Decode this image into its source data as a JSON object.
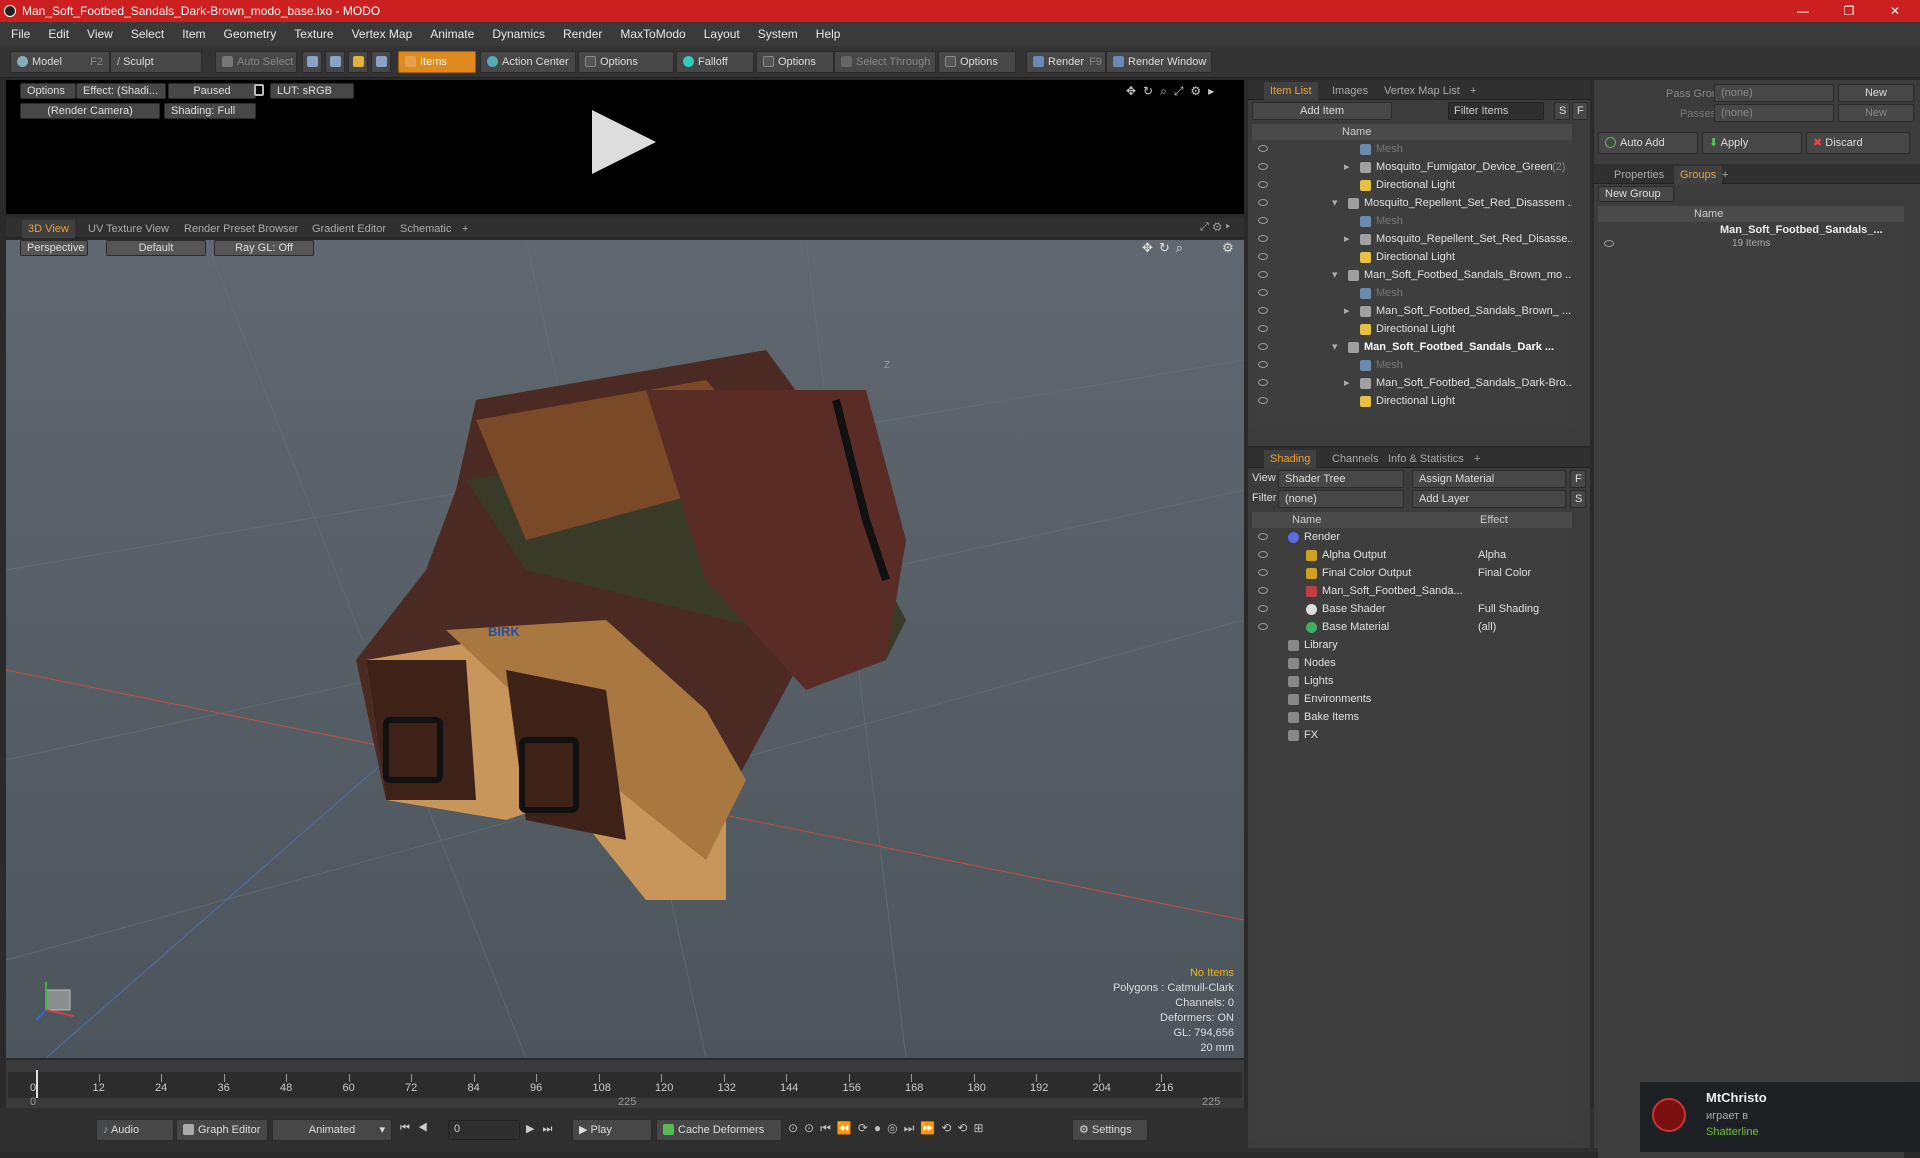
{
  "window": {
    "title": "Man_Soft_Footbed_Sandals_Dark-Brown_modo_base.lxo - MODO",
    "min": "—",
    "max": "❒",
    "close": "✕"
  },
  "menu": [
    "File",
    "Edit",
    "View",
    "Select",
    "Item",
    "Geometry",
    "Texture",
    "Vertex Map",
    "Animate",
    "Dynamics",
    "Render",
    "MaxToModo",
    "Layout",
    "System",
    "Help"
  ],
  "toolbar": {
    "model": "Model",
    "model_key": "F2",
    "sculpt": "Sculpt",
    "auto_select": "Auto Select",
    "items": "Items",
    "action_center": "Action Center",
    "options1": "Options",
    "falloff": "Falloff",
    "options2": "Options",
    "select_through": "Select Through",
    "options3": "Options",
    "render": "Render",
    "render_key": "F9",
    "render_window": "Render Window"
  },
  "preview": {
    "options": "Options",
    "effect": "Effect: (Shadi...",
    "paused": "Paused",
    "lut": "LUT: sRGB",
    "camera": "(Render Camera)",
    "shading": "Shading: Full"
  },
  "viewport_tabs": [
    "3D View",
    "UV Texture View",
    "Render Preset Browser",
    "Gradient Editor",
    "Schematic",
    "+"
  ],
  "viewport": {
    "perspective": "Perspective",
    "default": "Default",
    "raygl": "Ray GL: Off",
    "axis_label": "Z",
    "brand": "BIRK",
    "info": {
      "no_items": "No Items",
      "polygons": "Polygons : Catmull-Clark",
      "channels": "Channels: 0",
      "deformers": "Deformers: ON",
      "gl": "GL: 794,656",
      "size": "20 mm"
    }
  },
  "timeline": {
    "ticks": [
      "0",
      "12",
      "24",
      "36",
      "48",
      "60",
      "72",
      "84",
      "96",
      "108",
      "120",
      "132",
      "144",
      "156",
      "168",
      "180",
      "192",
      "204",
      "216"
    ],
    "start": "0",
    "mid": "225",
    "end": "225"
  },
  "bottom": {
    "audio": "Audio",
    "graph_editor": "Graph Editor",
    "animated": "Animated",
    "frame": "0",
    "play": "Play",
    "cache": "Cache Deformers",
    "settings": "Settings"
  },
  "item_list": {
    "tabs": [
      "Item List",
      "Images",
      "Vertex Map List",
      "+"
    ],
    "add_item": "Add Item",
    "filter": "Filter Items",
    "s": "S",
    "f": "F",
    "col_name": "Name",
    "rows": [
      {
        "label": "Mesh",
        "indent": 2,
        "dim": true
      },
      {
        "label": "Mosquito_Fumigator_Device_Green",
        "suffix": "(2)",
        "indent": 2,
        "dim": false
      },
      {
        "label": "Directional Light",
        "indent": 2,
        "dim": false
      },
      {
        "label": "Mosquito_Repellent_Set_Red_Disassem ...",
        "indent": 1,
        "dim": false
      },
      {
        "label": "Mesh",
        "indent": 2,
        "dim": true
      },
      {
        "label": "Mosquito_Repellent_Set_Red_Disasse...",
        "indent": 2,
        "dim": false
      },
      {
        "label": "Directional Light",
        "indent": 2,
        "dim": false
      },
      {
        "label": "Man_Soft_Footbed_Sandals_Brown_mo ...",
        "indent": 1,
        "dim": false
      },
      {
        "label": "Mesh",
        "indent": 2,
        "dim": true
      },
      {
        "label": "Man_Soft_Footbed_Sandals_Brown_ ...",
        "indent": 2,
        "dim": false
      },
      {
        "label": "Directional Light",
        "indent": 2,
        "dim": false
      },
      {
        "label": "Man_Soft_Footbed_Sandals_Dark ...",
        "indent": 1,
        "dim": false,
        "bold": true
      },
      {
        "label": "Mesh",
        "indent": 2,
        "dim": true
      },
      {
        "label": "Man_Soft_Footbed_Sandals_Dark-Bro...",
        "indent": 2,
        "dim": false
      },
      {
        "label": "Directional Light",
        "indent": 2,
        "dim": false
      }
    ]
  },
  "shading": {
    "tabs": [
      "Shading",
      "Channels",
      "Info & Statistics",
      "+"
    ],
    "view_label": "View",
    "view_value": "Shader Tree",
    "assign": "Assign Material",
    "filter_label": "Filter",
    "filter_value": "(none)",
    "add_layer": "Add Layer",
    "f": "F",
    "s": "S",
    "col_name": "Name",
    "col_effect": "Effect",
    "rows": [
      {
        "name": "Render",
        "effect": "",
        "indent": 0
      },
      {
        "name": "Alpha Output",
        "effect": "Alpha",
        "indent": 1
      },
      {
        "name": "Final Color Output",
        "effect": "Final Color",
        "indent": 1
      },
      {
        "name": "Man_Soft_Footbed_Sanda...",
        "effect": "",
        "indent": 1
      },
      {
        "name": "Base Shader",
        "effect": "Full Shading",
        "indent": 1
      },
      {
        "name": "Base Material",
        "effect": "(all)",
        "indent": 1
      },
      {
        "name": "Library",
        "effect": "",
        "indent": 0
      },
      {
        "name": "Nodes",
        "effect": "",
        "indent": 0
      },
      {
        "name": "Lights",
        "effect": "",
        "indent": 0
      },
      {
        "name": "Environments",
        "effect": "",
        "indent": 0
      },
      {
        "name": "Bake Items",
        "effect": "",
        "indent": 0
      },
      {
        "name": "FX",
        "effect": "",
        "indent": 0
      }
    ]
  },
  "groups": {
    "pass_groups": "Pass Groups",
    "passes": "Passes",
    "none": "(none)",
    "new": "New",
    "auto_add": "Auto Add",
    "apply": "Apply",
    "discard": "Discard",
    "tabs": [
      "Properties",
      "Groups",
      "+"
    ],
    "new_group": "New Group",
    "col_name": "Name",
    "item_name": "Man_Soft_Footbed_Sandals_...",
    "item_count": "19 Items"
  },
  "notification": {
    "user": "MtChristo",
    "status": "играет в",
    "game": "Shatterline"
  }
}
